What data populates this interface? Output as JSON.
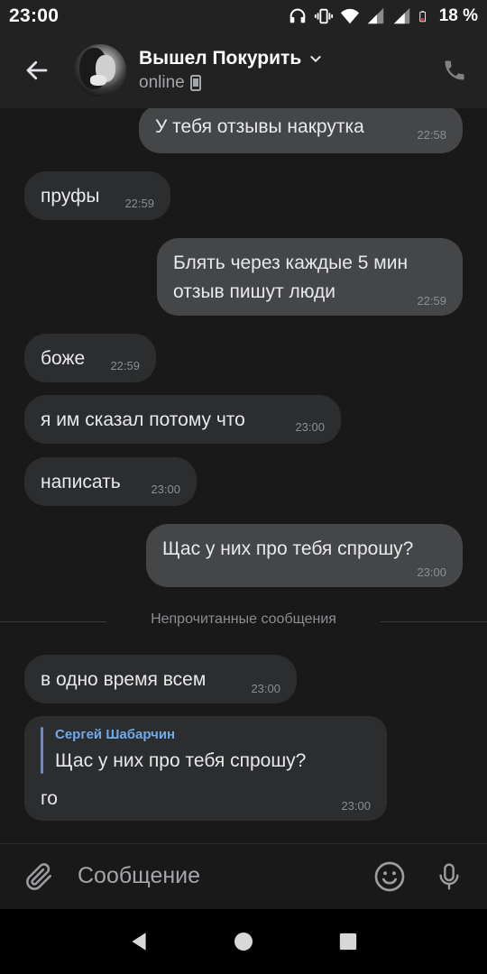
{
  "status_bar": {
    "time": "23:00",
    "battery_pct": "18 %"
  },
  "header": {
    "title": "Вышел Покурить",
    "status": "online"
  },
  "messages": [
    {
      "dir": "out",
      "text": "У тебя отзывы накрутка",
      "time": "22:58"
    },
    {
      "dir": "in",
      "text": "пруфы",
      "time": "22:59"
    },
    {
      "dir": "out",
      "line1": "Блять через каждые 5 мин",
      "line2": "отзыв пишут люди",
      "time": "22:59"
    },
    {
      "dir": "in",
      "text": "боже",
      "time": "22:59"
    },
    {
      "dir": "in",
      "text": "я им сказал потому что",
      "time": "23:00"
    },
    {
      "dir": "in",
      "text": "написать",
      "time": "23:00"
    },
    {
      "dir": "out",
      "text": "Щас у них про тебя спрошу?",
      "time": "23:00"
    },
    {
      "dir": "in",
      "text": "в одно время всем",
      "time": "23:00"
    },
    {
      "dir": "in",
      "reply_name": "Сергей Шабарчин",
      "reply_text": "Щас у них про тебя спрошу?",
      "text": "го",
      "time": "23:00"
    }
  ],
  "divider_label": "Непрочитанные сообщения",
  "input": {
    "placeholder": "Сообщение"
  },
  "icons": {
    "back": "arrow-left-icon",
    "call": "phone-icon",
    "attach": "paperclip-icon",
    "emoji": "smile-icon",
    "mic": "microphone-icon",
    "nav_back": "triangle-back-icon",
    "nav_home": "circle-home-icon",
    "nav_recent": "square-recent-icon"
  },
  "colors": {
    "background": "#19191a",
    "incoming": "#2c2d2e",
    "outgoing": "#454647",
    "accent": "#71aaeb"
  }
}
